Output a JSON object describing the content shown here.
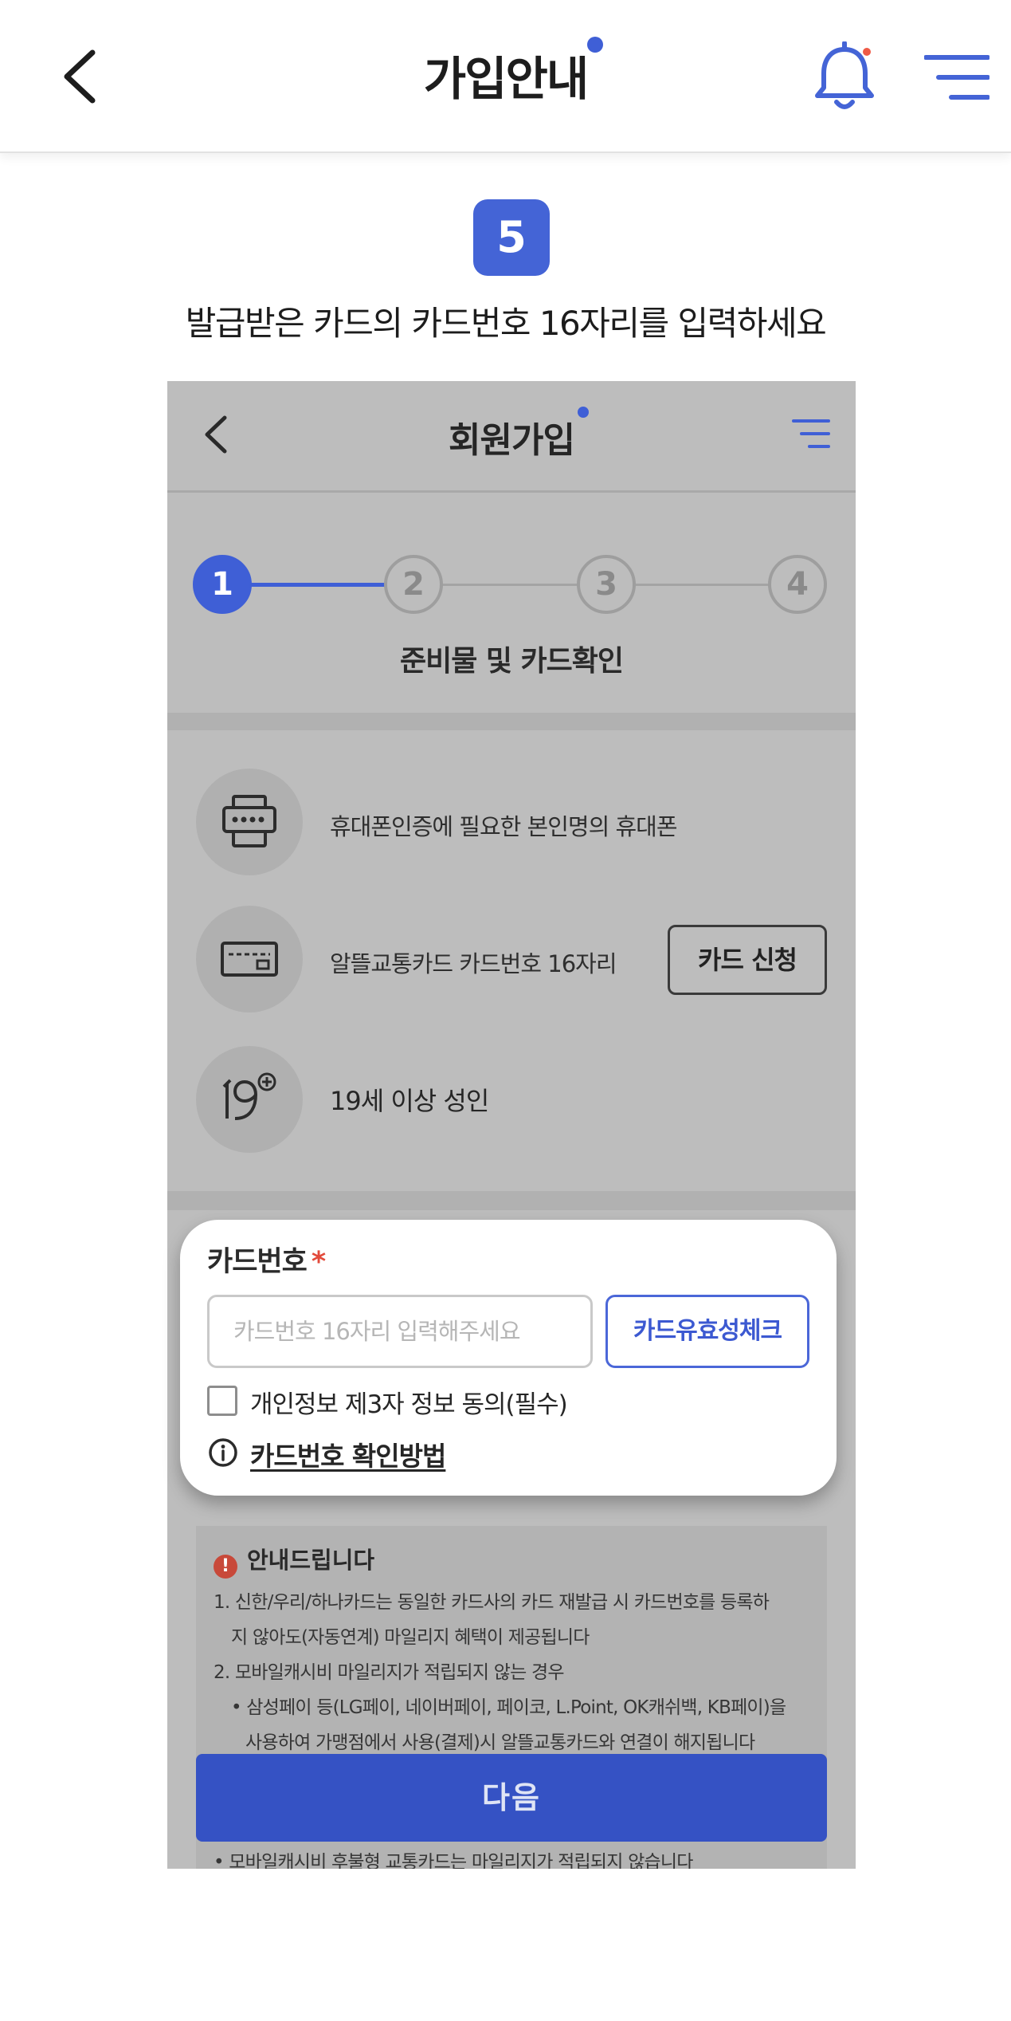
{
  "header": {
    "title": "가입안내",
    "back_icon": "chevron-left-icon",
    "bell_icon": "bell-icon",
    "menu_icon": "hamburger-menu-icon",
    "accent_color": "#4464d6"
  },
  "step": {
    "number": "5",
    "description": "발급받은 카드의 카드번호 16자리를 입력하세요"
  },
  "screenshot": {
    "header": {
      "title": "회원가입"
    },
    "stepper": {
      "steps": [
        "1",
        "2",
        "3",
        "4"
      ],
      "active_step": 1,
      "label": "준비물 및 카드확인"
    },
    "requirements": [
      {
        "icon": "phone-auth-icon",
        "text": "휴대폰인증에 필요한 본인명의 휴대폰"
      },
      {
        "icon": "card-icon",
        "text": "알뜰교통카드 카드번호 16자리",
        "button": "카드 신청"
      },
      {
        "icon": "age-19-plus-icon",
        "text": "19세 이상 성인"
      }
    ],
    "card_form": {
      "label": "카드번호",
      "required_mark": "*",
      "input_placeholder": "카드번호 16자리 입력해주세요",
      "input_value": "",
      "validity_button": "카드유효성체크",
      "consent_label": "개인정보 제3자 정보 동의(필수)",
      "consent_checked": false,
      "howto_link": "카드번호 확인방법"
    },
    "notice": {
      "title": "안내드립니다",
      "lines": [
        "1. 신한/우리/하나카드는 동일한 카드사의 카드 재발급 시 카드번호를 등록하",
        "지 않아도(자동연계) 마일리지 혜택이 제공됩니다",
        "2.  모바일캐시비 마일리지가 적립되지 않는 경우",
        "• 삼성페이 등(LG페이, 네이버페이, 페이코, L.Point, OK캐쉬백, KB페이)을",
        "사용하여 가맹점에서 사용(결제)시 알뜰교통카드와 연결이 해지됩니다"
      ],
      "tail": "• 모바일캐시비 후불형 교통카드는 마일리지가 적립되지 않습니다"
    },
    "next_button": "다음"
  }
}
